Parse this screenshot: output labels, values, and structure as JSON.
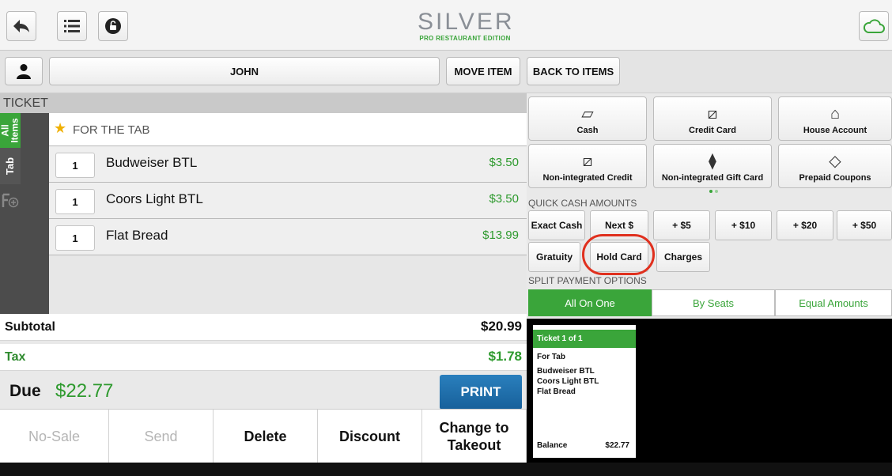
{
  "header": {
    "logo_main": "SILVER",
    "logo_sub": "PRO RESTAURANT EDITION"
  },
  "toolbar": {
    "customer_name": "JOHN",
    "move_item": "MOVE ITEM",
    "back_to_items": "BACK TO ITEMS"
  },
  "ticket": {
    "title": "TICKET",
    "side_tabs": [
      "All Items",
      "Tab"
    ],
    "group_label": "FOR THE TAB",
    "items": [
      {
        "qty": "1",
        "name": "Budweiser BTL",
        "price": "$3.50"
      },
      {
        "qty": "1",
        "name": "Coors Light BTL",
        "price": "$3.50"
      },
      {
        "qty": "1",
        "name": "Flat Bread",
        "price": "$13.99"
      }
    ]
  },
  "totals": {
    "subtotal_label": "Subtotal",
    "subtotal": "$20.99",
    "tax_label": "Tax",
    "tax": "$1.78",
    "due_label": "Due",
    "due": "$22.77",
    "print": "PRINT"
  },
  "actions": {
    "no_sale": "No-Sale",
    "send": "Send",
    "delete": "Delete",
    "discount": "Discount",
    "change_to_takeout": "Change to Takeout"
  },
  "payment_methods": [
    {
      "label": "Cash",
      "icon": "cash-icon"
    },
    {
      "label": "Credit Card",
      "icon": "credit-card-icon"
    },
    {
      "label": "House Account",
      "icon": "house-icon"
    },
    {
      "label": "Non-integrated Credit",
      "icon": "credit-card-icon"
    },
    {
      "label": "Non-integrated Gift Card",
      "icon": "gift-card-icon"
    },
    {
      "label": "Prepaid Coupons",
      "icon": "coupon-icon"
    }
  ],
  "quick_cash": {
    "title": "QUICK CASH AMOUNTS",
    "amounts": [
      "Exact Cash",
      "Next $",
      "+ $5",
      "+ $10",
      "+ $20",
      "+ $50"
    ],
    "extras": [
      "Gratuity",
      "Hold Card",
      "Charges"
    ]
  },
  "split_payment": {
    "title": "SPLIT PAYMENT OPTIONS",
    "options": [
      "All On One",
      "By Seats",
      "Equal Amounts"
    ]
  },
  "receipt": {
    "header": "Ticket 1 of 1",
    "group": "For Tab",
    "items": [
      "Budweiser BTL",
      "Coors Light BTL",
      "Flat Bread"
    ],
    "balance_label": "Balance",
    "balance": "$22.77"
  },
  "colors": {
    "accent_green": "#3aa53a",
    "print_blue": "#1f6fa8",
    "highlight_red": "#e0301e"
  }
}
